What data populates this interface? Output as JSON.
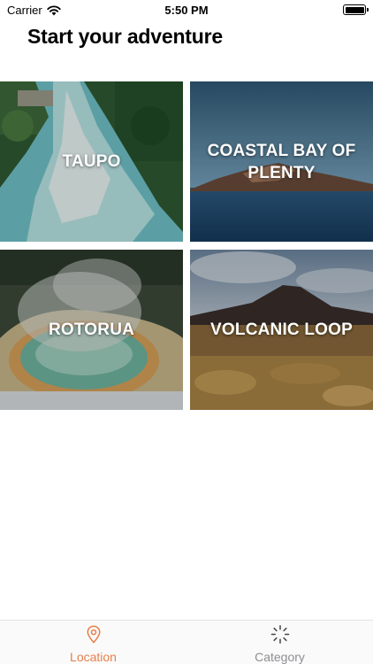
{
  "status_bar": {
    "carrier": "Carrier",
    "time": "5:50 PM"
  },
  "page": {
    "title": "Start your adventure"
  },
  "tiles": [
    {
      "label": "TAUPO",
      "image": "river-rapids-aerial"
    },
    {
      "label": "COASTAL BAY OF PLENTY",
      "image": "island-at-sea"
    },
    {
      "label": "ROTORUA",
      "image": "geothermal-hot-spring"
    },
    {
      "label": "VOLCANIC LOOP",
      "image": "volcano-tussock-plain"
    }
  ],
  "tab_bar": {
    "tabs": [
      {
        "label": "Location",
        "icon": "map-pin-icon",
        "active": true
      },
      {
        "label": "Category",
        "icon": "category-burst-icon",
        "active": false
      }
    ]
  },
  "colors": {
    "accent": "#e8804a",
    "inactive": "#8e8e93"
  }
}
